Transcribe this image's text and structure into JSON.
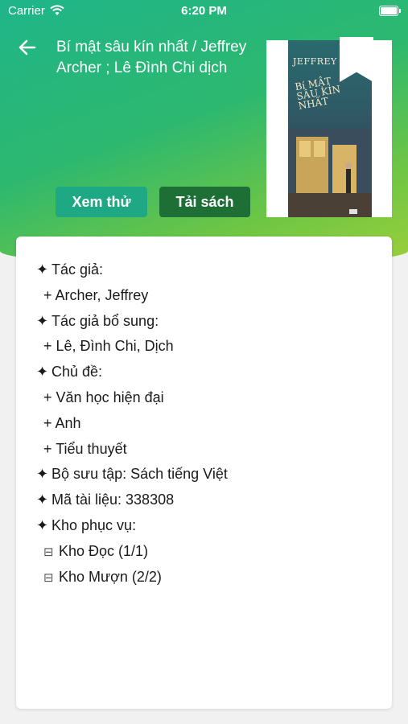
{
  "status_bar": {
    "carrier": "Carrier",
    "time": "6:20 PM"
  },
  "header": {
    "title": "Bí mật sâu kín nhất / Jeffrey Archer ; Lê Đình Chi dịch",
    "preview_label": "Xem thử",
    "download_label": "Tải sách"
  },
  "cover": {
    "author_text": "JEFFREY AR",
    "title_line1": "Bí MẬT",
    "title_line2": "SÂU KÍN NHẤT"
  },
  "details": {
    "star": "✦",
    "plus": "+",
    "box": "⊟",
    "author_label": "Tác giả:",
    "author_value": "Archer, Jeffrey",
    "co_author_label": "Tác giả bổ sung:",
    "co_author_value": "Lê, Đình Chi, Dịch",
    "subject_label": "Chủ đề:",
    "subjects": [
      "Văn học hiện đại",
      "Anh",
      "Tiểu thuyết"
    ],
    "collection": "Bộ sưu tập: Sách tiếng Việt",
    "doc_id": "Mã tài liệu: 338308",
    "storage_label": "Kho phục vụ:",
    "storages": [
      "Kho Đọc (1/1)",
      "Kho Mượn (2/2)"
    ]
  },
  "colors": {
    "gradient_top": "#1fb58a",
    "gradient_bottom": "#9ccf3a",
    "preview_button": "#1ea984",
    "download_button": "#1e6f36"
  },
  "icons": {
    "back": "arrow-left-icon",
    "wifi": "wifi-icon",
    "battery": "battery-icon",
    "bookmark": "bookmark-icon"
  }
}
